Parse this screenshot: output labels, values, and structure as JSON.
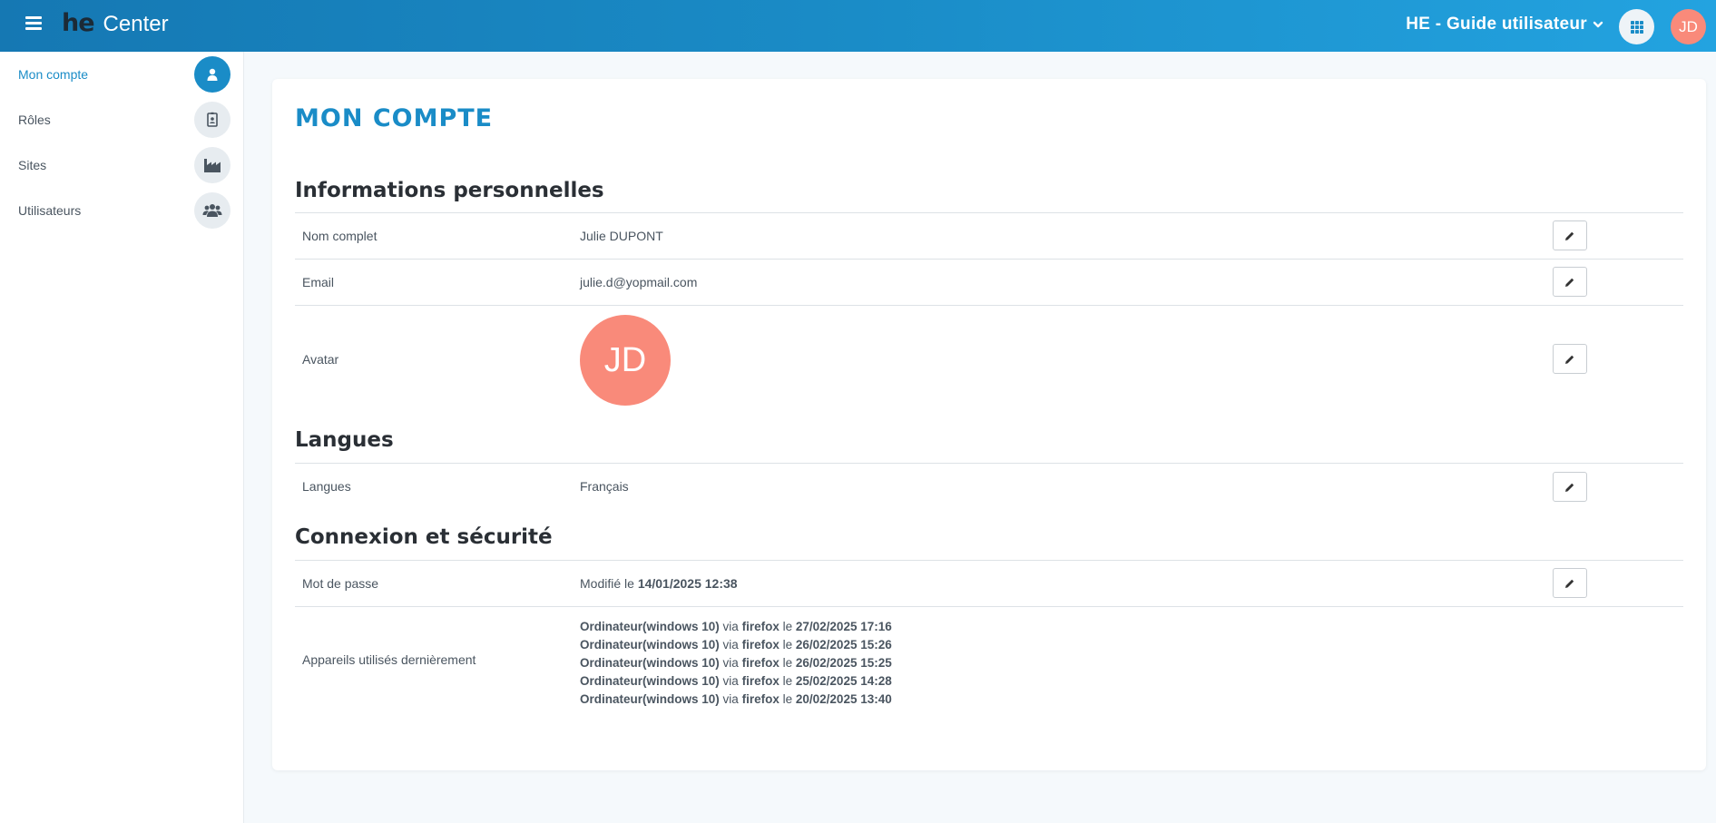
{
  "header": {
    "logo_he": "he",
    "logo_center": "Center",
    "org_name": "HE - Guide utilisateur",
    "avatar_initials": "JD",
    "avatar_color": "#f98a7a",
    "brand_color": "#1a8cc7"
  },
  "sidebar": {
    "items": [
      {
        "label": "Mon compte",
        "icon": "user-icon",
        "active": true
      },
      {
        "label": "Rôles",
        "icon": "badge-icon",
        "active": false
      },
      {
        "label": "Sites",
        "icon": "factory-icon",
        "active": false
      },
      {
        "label": "Utilisateurs",
        "icon": "users-icon",
        "active": false
      }
    ]
  },
  "main": {
    "title": "MON COMPTE",
    "personal": {
      "title": "Informations personnelles",
      "name_label": "Nom complet",
      "name_value": "Julie DUPONT",
      "email_label": "Email",
      "email_value": "julie.d@yopmail.com",
      "avatar_label": "Avatar",
      "avatar_initials": "JD"
    },
    "languages": {
      "title": "Langues",
      "label": "Langues",
      "value": "Français"
    },
    "security": {
      "title": "Connexion et sécurité",
      "password_label": "Mot de passe",
      "password_prefix": "Modifié le",
      "password_date": "14/01/2025 12:38",
      "devices_label": "Appareils utilisés dernièrement",
      "via": "via",
      "le": "le",
      "devices": [
        {
          "device": "Ordinateur(windows 10)",
          "browser": "firefox",
          "date": "27/02/2025 17:16"
        },
        {
          "device": "Ordinateur(windows 10)",
          "browser": "firefox",
          "date": "26/02/2025 15:26"
        },
        {
          "device": "Ordinateur(windows 10)",
          "browser": "firefox",
          "date": "26/02/2025 15:25"
        },
        {
          "device": "Ordinateur(windows 10)",
          "browser": "firefox",
          "date": "25/02/2025 14:28"
        },
        {
          "device": "Ordinateur(windows 10)",
          "browser": "firefox",
          "date": "20/02/2025 13:40"
        }
      ]
    }
  }
}
